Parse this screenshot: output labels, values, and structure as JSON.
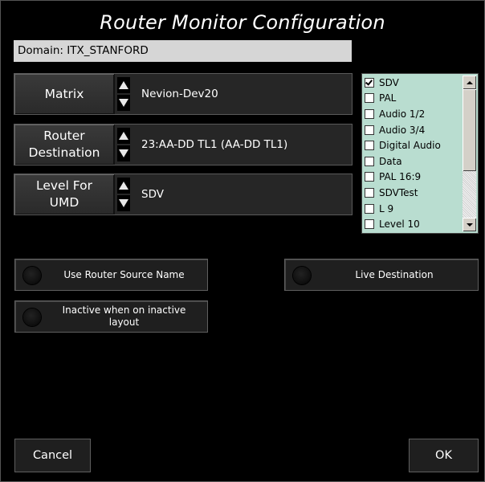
{
  "window": {
    "title": "Router Monitor Configuration"
  },
  "domain": {
    "text": "Domain: ITX_STANFORD"
  },
  "rows": [
    {
      "label": "Matrix",
      "value": "Nevion-Dev20"
    },
    {
      "label_line1": "Router",
      "label_line2": "Destination",
      "value": "23:AA-DD TL1 (AA-DD TL1)"
    },
    {
      "label_line1": "Level For",
      "label_line2": "UMD",
      "value": "SDV"
    }
  ],
  "levels": {
    "items": [
      {
        "label": "SDV",
        "checked": true
      },
      {
        "label": "PAL",
        "checked": false
      },
      {
        "label": "Audio 1/2",
        "checked": false
      },
      {
        "label": "Audio 3/4",
        "checked": false
      },
      {
        "label": "Digital Audio",
        "checked": false
      },
      {
        "label": "Data",
        "checked": false
      },
      {
        "label": "PAL 16:9",
        "checked": false
      },
      {
        "label": "SDVTest",
        "checked": false
      },
      {
        "label": "L 9",
        "checked": false
      },
      {
        "label": "Level 10",
        "checked": false
      }
    ]
  },
  "toggles": {
    "use_router_source_name": "Use Router Source Name",
    "live_destination": "Live Destination",
    "inactive_line1": "Inactive when on inactive",
    "inactive_line2": "layout"
  },
  "footer": {
    "cancel": "Cancel",
    "ok": "OK"
  },
  "colors": {
    "listbox_bg": "#b9ddd0",
    "domain_bg": "#d6d6d6",
    "background": "#000000"
  }
}
